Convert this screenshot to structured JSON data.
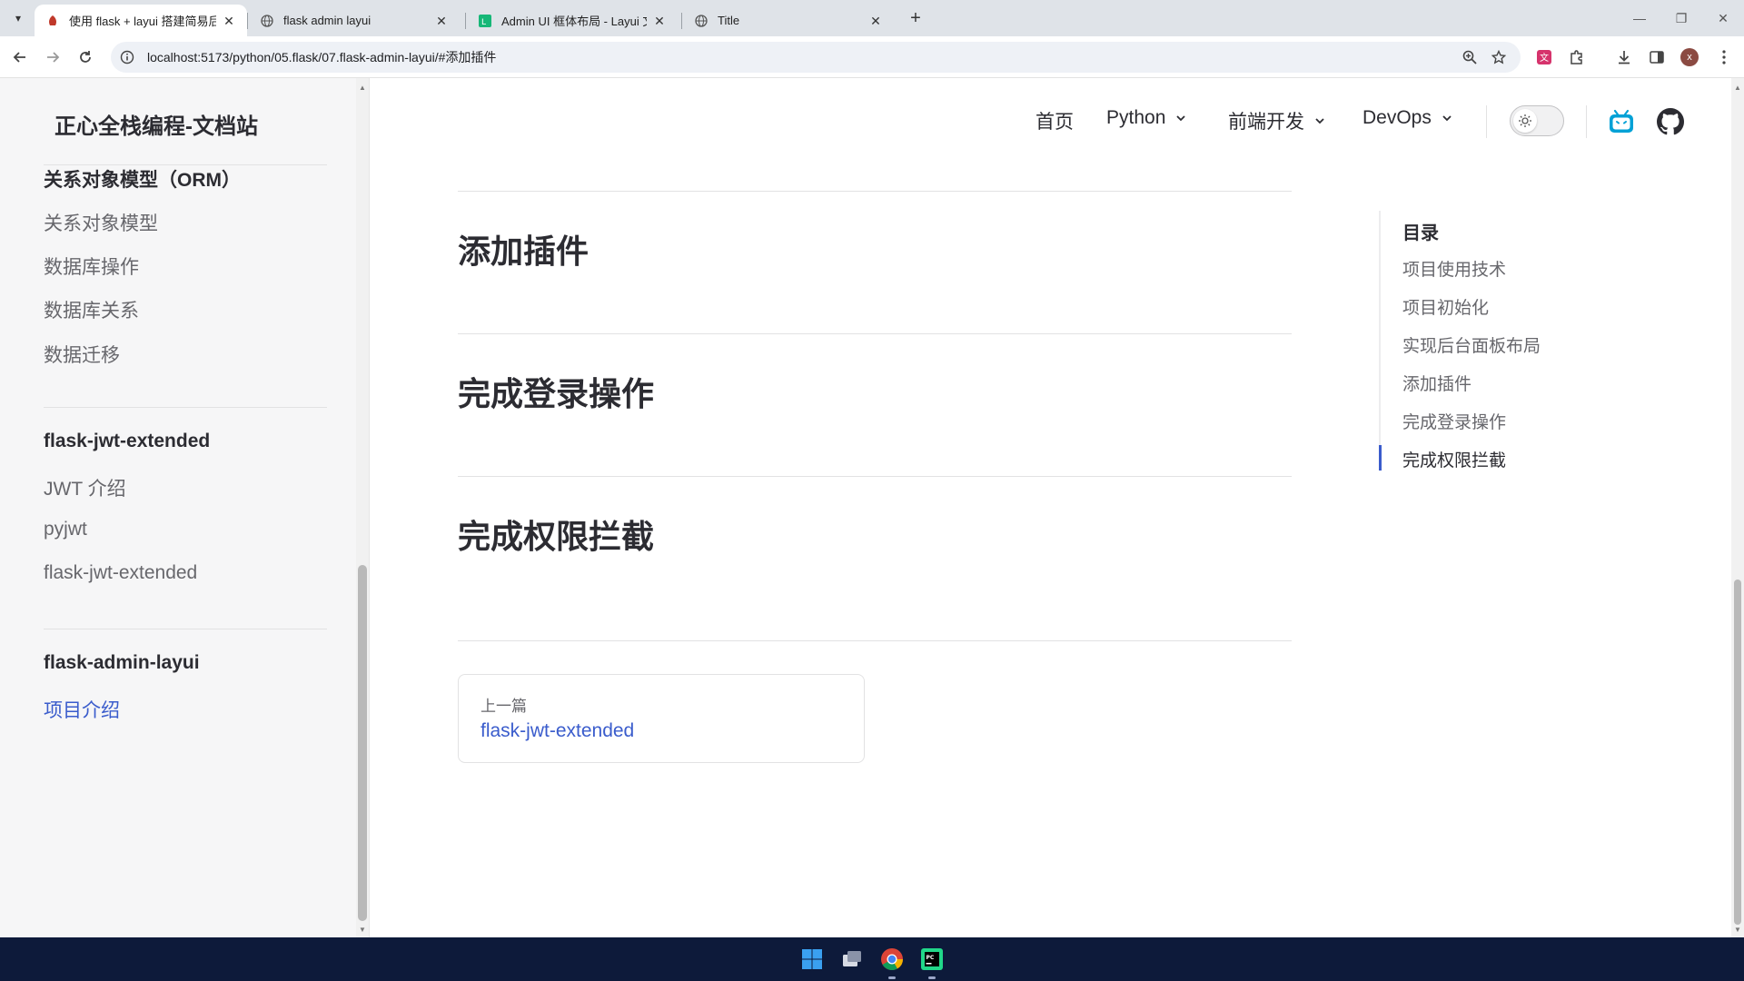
{
  "browser": {
    "tabs": [
      {
        "title": "使用 flask + layui 搭建简易后台",
        "active": true
      },
      {
        "title": "flask admin layui",
        "active": false
      },
      {
        "title": "Admin UI 框体布局 - Layui 文档",
        "active": false
      },
      {
        "title": "Title",
        "active": false
      }
    ],
    "url": "localhost:5173/python/05.flask/07.flask-admin-layui/#添加插件",
    "profile_initial": "x"
  },
  "site": {
    "title": "正心全栈编程-文档站"
  },
  "sidebar": {
    "groups": [
      {
        "title": "关系对象模型（ORM）",
        "items": [
          "关系对象模型",
          "数据库操作",
          "数据库关系",
          "数据迁移"
        ]
      },
      {
        "title": "flask-jwt-extended",
        "items": [
          "JWT 介绍",
          "pyjwt",
          "flask-jwt-extended"
        ]
      },
      {
        "title": "flask-admin-layui",
        "items": [
          "项目介绍"
        ]
      }
    ]
  },
  "nav": {
    "home": "首页",
    "python": "Python",
    "frontend": "前端开发",
    "devops": "DevOps"
  },
  "doc": {
    "headings": [
      "添加插件",
      "完成登录操作",
      "完成权限拦截"
    ],
    "prev": {
      "label": "上一篇",
      "title": "flask-jwt-extended"
    }
  },
  "outline": {
    "title": "目录",
    "items": [
      "项目使用技术",
      "项目初始化",
      "实现后台面板布局",
      "添加插件",
      "完成登录操作",
      "完成权限拦截"
    ],
    "active_index": 5
  },
  "colors": {
    "brand": "#3a5ccc",
    "taskbar": "#0d1a3a"
  },
  "icons": [
    "chevron-down-icon",
    "sun-icon",
    "bilibili-icon",
    "github-icon",
    "windows-start-icon",
    "chrome-icon",
    "pycharm-icon"
  ]
}
